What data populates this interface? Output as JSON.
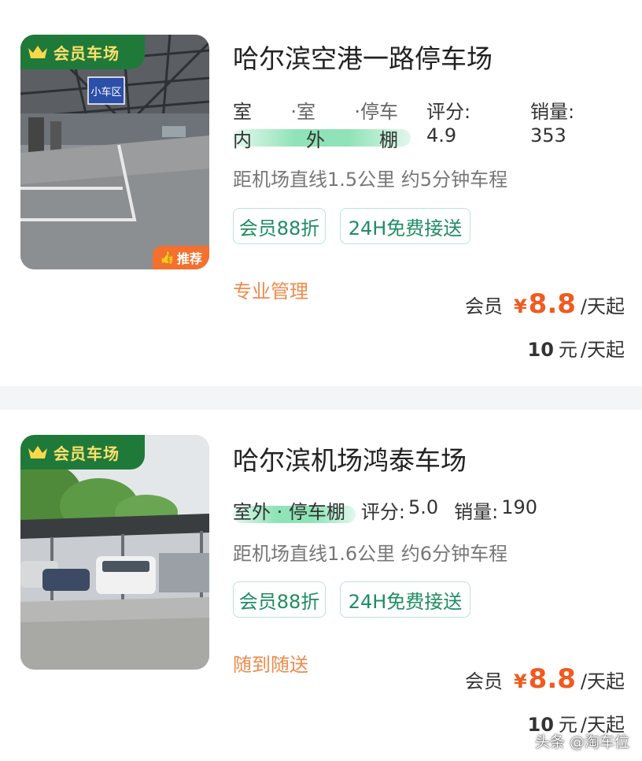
{
  "listings": [
    {
      "badge": "会员车场",
      "recommend_label": "推荐",
      "photo_sign": "小车区",
      "name": "哈尔滨空港一路停车场",
      "features": [
        "室",
        "·室",
        "·停车",
        "内",
        "外",
        "棚"
      ],
      "rating_label": "评分:",
      "rating": "4.9",
      "sales_label": "销量:",
      "sales": "353",
      "distance": "距机场直线1.5公里 约5分钟车程",
      "tags": [
        "会员88折",
        "24H免费接送"
      ],
      "service": "专业管理",
      "member_label": "会员",
      "currency": "¥",
      "member_price": "8.8",
      "price_unit": "/天起",
      "original_price": "10",
      "original_currency": "元",
      "original_unit": "/天起"
    },
    {
      "badge": "会员车场",
      "name": "哈尔滨机场鸿泰车场",
      "features_text": "室外 · 停车棚",
      "rating_label": "评分:",
      "rating": "5.0",
      "sales_label": "销量:",
      "sales": "190",
      "distance": "距机场直线1.6公里 约6分钟车程",
      "tags": [
        "会员88折",
        "24H免费接送"
      ],
      "service": "随到随送",
      "member_label": "会员",
      "currency": "¥",
      "member_price": "8.8",
      "price_unit": "/天起",
      "original_price": "10",
      "original_currency": "元",
      "original_unit": "/天起"
    }
  ],
  "watermark": "头条 @淘车位",
  "colors": {
    "badge_bg": "#1f7a3a",
    "badge_text": "#ffe06a",
    "price": "#f05a20",
    "tag_text": "#1f8c65",
    "service_text": "#f08a4b",
    "recommend_bg": "#f3702f",
    "highlight": "#8fe3b7"
  },
  "icons": [
    "crown-icon",
    "thumbs-up-icon"
  ]
}
